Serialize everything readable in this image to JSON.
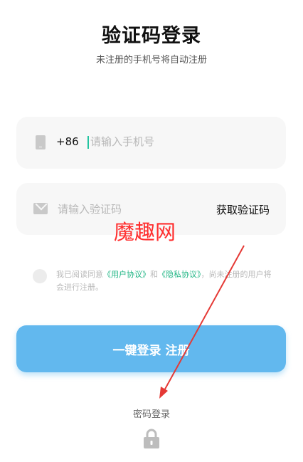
{
  "header": {
    "title": "验证码登录",
    "subtitle": "未注册的手机号将自动注册"
  },
  "phone": {
    "icon": "phone-icon",
    "country_code": "+86",
    "placeholder": "请输入手机号",
    "value": ""
  },
  "code": {
    "icon": "mail-icon",
    "placeholder": "请输入验证码",
    "value": "",
    "get_code_label": "获取验证码"
  },
  "watermark": "魔趣网",
  "agreement": {
    "prefix": "我已阅读同意",
    "user_agreement": "《用户协议》",
    "and": "和",
    "privacy_agreement": "《隐私协议》",
    "suffix": "，尚未注册的用户将会进行注册。",
    "checked": false
  },
  "login_button": "一键登录 注册",
  "password_login": "密码登录",
  "colors": {
    "accent": "#62b8ee",
    "link": "#1fb584",
    "cursor": "#22c4a0",
    "annotation": "#e53935"
  }
}
